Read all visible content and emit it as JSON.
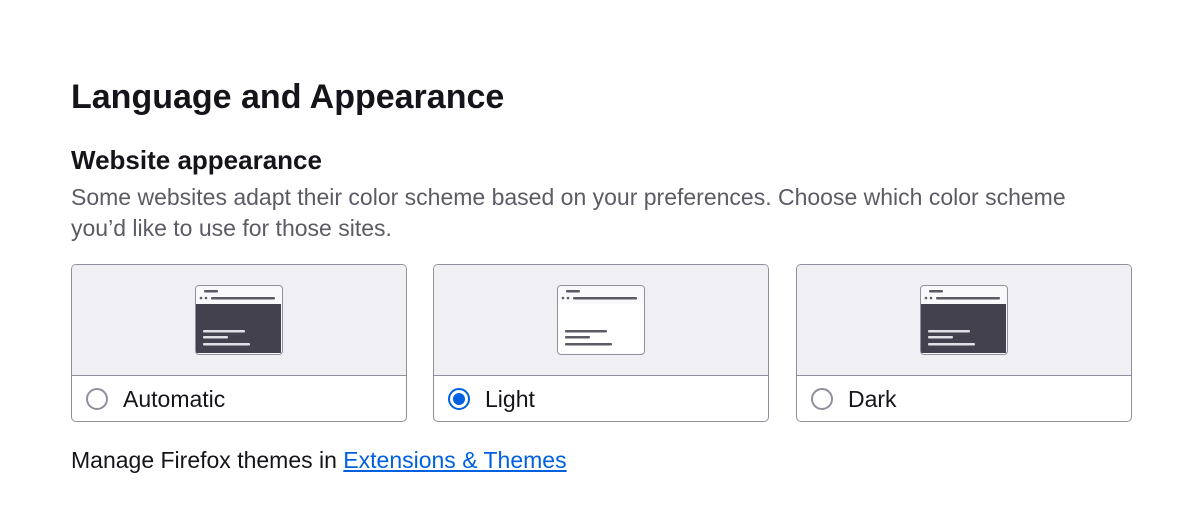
{
  "section": {
    "title": "Language and Appearance"
  },
  "website_appearance": {
    "heading": "Website appearance",
    "description": "Some websites adapt their color scheme based on your preferences. Choose which color scheme you’d like to use for those sites.",
    "options": [
      {
        "label": "Automatic",
        "selected": false,
        "preview": "auto"
      },
      {
        "label": "Light",
        "selected": true,
        "preview": "light"
      },
      {
        "label": "Dark",
        "selected": false,
        "preview": "dark"
      }
    ]
  },
  "footer": {
    "text": "Manage Firefox themes in ",
    "link_label": "Extensions & Themes"
  },
  "colors": {
    "accent": "#0061e0",
    "border": "#8f8f9d",
    "preview_bg": "#f0f0f4",
    "dark_content": "#42414d",
    "light_content": "#ffffff"
  }
}
